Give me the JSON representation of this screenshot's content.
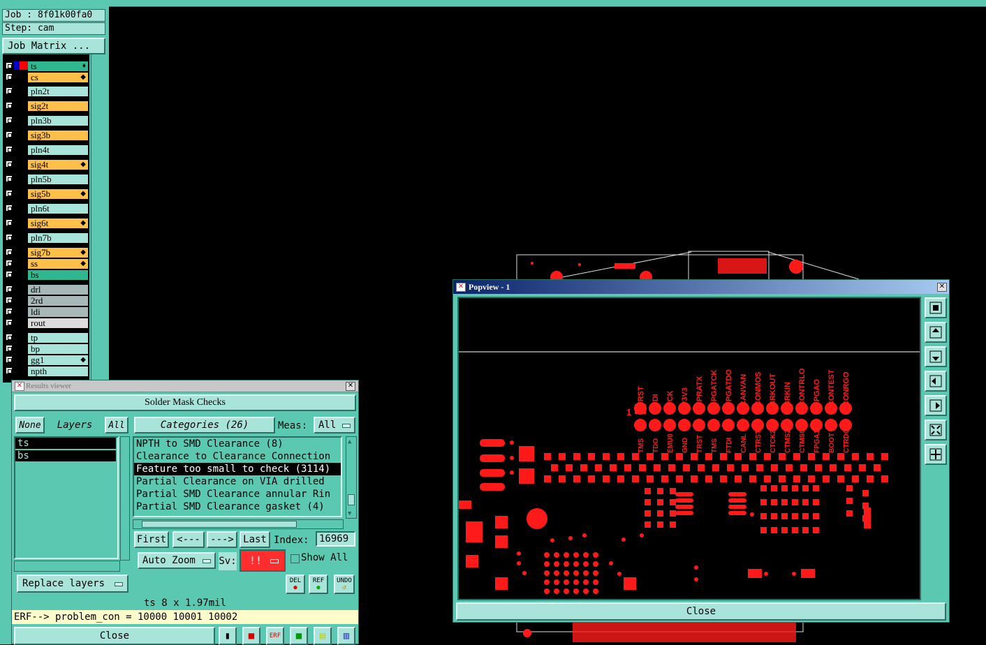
{
  "left_panel": {
    "job_label": "Job : 8f01k00fa0",
    "step_label": "Step: cam",
    "job_matrix_button": "Job Matrix ...",
    "layers": [
      {
        "name": "ts",
        "color": "#2fb88f",
        "flag": "♦"
      },
      {
        "name": "cs",
        "color": "#ffc04a",
        "flag": "◆"
      },
      {
        "name": "pln2t",
        "color": "#a8e4d9",
        "flag": ""
      },
      {
        "name": "sig2t",
        "color": "#ffc04a",
        "flag": ""
      },
      {
        "name": "pln3b",
        "color": "#a8e4d9",
        "flag": ""
      },
      {
        "name": "sig3b",
        "color": "#ffc04a",
        "flag": ""
      },
      {
        "name": "pln4t",
        "color": "#a8e4d9",
        "flag": ""
      },
      {
        "name": "sig4t",
        "color": "#ffc04a",
        "flag": "◆"
      },
      {
        "name": "pln5b",
        "color": "#a8e4d9",
        "flag": ""
      },
      {
        "name": "sig5b",
        "color": "#ffc04a",
        "flag": "◆"
      },
      {
        "name": "pln6t",
        "color": "#a8e4d9",
        "flag": ""
      },
      {
        "name": "sig6t",
        "color": "#ffc04a",
        "flag": "◆"
      },
      {
        "name": "pln7b",
        "color": "#a8e4d9",
        "flag": ""
      },
      {
        "name": "sig7b",
        "color": "#ffc04a",
        "flag": "◆"
      },
      {
        "name": "ss",
        "color": "#ffc04a",
        "flag": "◆"
      },
      {
        "name": "bs",
        "color": "#2fb88f",
        "flag": ""
      },
      {
        "name": "drl",
        "color": "#a6b8b8",
        "flag": ""
      },
      {
        "name": "2rd",
        "color": "#a6b8b8",
        "flag": ""
      },
      {
        "name": "ldi",
        "color": "#a6b8b8",
        "flag": ""
      },
      {
        "name": "rout",
        "color": "#dcdcdc",
        "flag": ""
      },
      {
        "name": "tp",
        "color": "#a8e4d9",
        "flag": ""
      },
      {
        "name": "bp",
        "color": "#a8e4d9",
        "flag": ""
      },
      {
        "name": "gg1",
        "color": "#a8e4d9",
        "flag": "◆"
      },
      {
        "name": "npth",
        "color": "#a8e4d9",
        "flag": ""
      }
    ]
  },
  "results_viewer": {
    "title": "Results viewer",
    "header": "Solder Mask Checks",
    "none_button": "None",
    "layers_label": "Layers",
    "all_button": "All",
    "selected_layers": [
      "ts",
      "bs"
    ],
    "categories_label": "Categories (26)",
    "meas_label": "Meas:",
    "meas_value": "All",
    "categories": [
      "NPTH to SMD Clearance (8)",
      "Clearance to Clearance Connection",
      "Feature too small to check (3114)",
      "Partial Clearance on VIA drilled",
      "Partial SMD Clearance annular Rin",
      "Partial SMD Clearance gasket (4)"
    ],
    "selected_category_index": 2,
    "first_button": "First",
    "prev_button": "<---",
    "next_button": "--->",
    "last_button": "Last",
    "index_label": "Index:",
    "index_value": "16969",
    "zoom_select": "Auto Zoom",
    "sv_label": "Sv:",
    "sv_value": "!!",
    "show_all_label": "Show All",
    "replace_layers_button": "Replace layers",
    "del_label": "DEL",
    "ref_label": "REF",
    "undo_label": "UNDO",
    "status_text": "ts 8 x 1.97mil",
    "message_text": "ERF--> problem_con = 10000 10001 10002",
    "close_button": "Close"
  },
  "popview": {
    "title": "Popview - 1",
    "close_button": "Close",
    "net_labels_top": [
      "TRST",
      "TDI",
      "TCK",
      "P3V3",
      "FPRATX",
      "FPGATCK",
      "FPGATDO",
      "CANVAN",
      "CONMOS",
      "BRKOUT",
      "BRKIN",
      "CONTRLO",
      "FPGAO",
      "CONTEST",
      "CONRGO"
    ],
    "net_labels_bottom": [
      "TMS",
      "TDO",
      "EMU0",
      "GND",
      "TRST",
      "TMS",
      "FTDI",
      "CANL",
      "CTRST",
      "CTCK2",
      "CTMS2",
      "CTMS0",
      "FPGA1",
      "BOOT",
      "CTRDO"
    ],
    "pin1_label": "1"
  },
  "colors": {
    "panel": "#5bc9b2",
    "field": "#a8e4d9",
    "copper": "#ff1a1a",
    "selection": "#000000"
  }
}
